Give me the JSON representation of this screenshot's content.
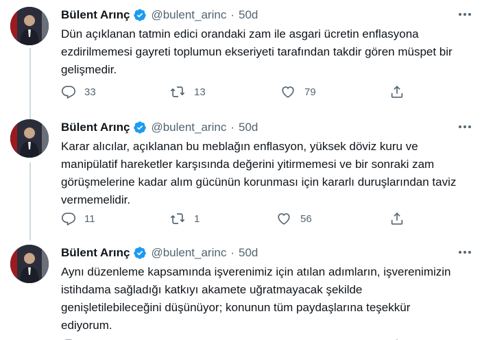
{
  "tweets": [
    {
      "name": "Bülent Arınç",
      "handle": "@bulent_arinc",
      "separator": "·",
      "time": "50d",
      "lines": [
        "Dün açıklanan tatmin edici orandaki zam ile asgari ücretin enflasyona",
        "ezdirilmemesi gayreti toplumun ekseriyeti tarafından takdir gören müspet bir",
        "gelişmedir."
      ],
      "replies": "33",
      "retweets": "13",
      "likes": "79"
    },
    {
      "name": "Bülent Arınç",
      "handle": "@bulent_arinc",
      "separator": "·",
      "time": "50d",
      "lines": [
        "Karar alıcılar, açıklanan bu meblağın enflasyon, yüksek döviz kuru ve",
        "manipülatif hareketler karşısında değerini yitirmemesi ve bir sonraki zam",
        "görüşmelerine kadar alım gücünün korunması için kararlı duruşlarından taviz",
        "vermemelidir."
      ],
      "replies": "11",
      "retweets": "1",
      "likes": "56"
    },
    {
      "name": "Bülent Arınç",
      "handle": "@bulent_arinc",
      "separator": "·",
      "time": "50d",
      "lines": [
        "Aynı düzenleme kapsamında işverenimiz için atılan adımların, işverenimizin",
        "istihdama sağladığı katkıyı akamete uğratmayacak şekilde",
        "genişletilebileceğini düşünüyor; konunun tüm paydaşlarına teşekkür",
        "ediyorum."
      ]
    }
  ],
  "icons": {
    "verified": "verified-badge-icon",
    "more": "more-dots-icon",
    "reply": "reply-icon",
    "retweet": "retweet-icon",
    "like": "heart-icon",
    "share": "share-icon"
  },
  "colors": {
    "verified": "#1d9bf0",
    "text": "#0f1419",
    "secondary": "#536471",
    "thread_line": "#cfd9de"
  }
}
